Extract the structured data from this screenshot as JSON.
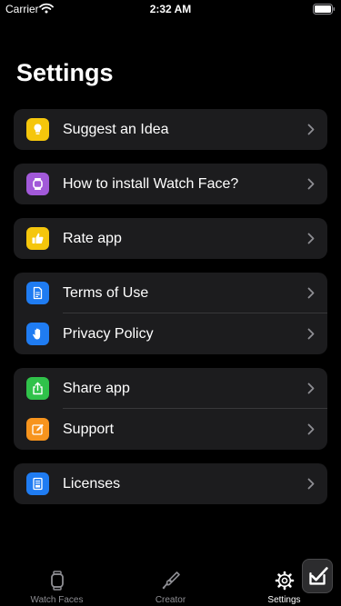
{
  "status": {
    "carrier": "Carrier",
    "time": "2:32 AM"
  },
  "page": {
    "title": "Settings"
  },
  "groups": [
    {
      "rows": [
        {
          "label": "Suggest an Idea",
          "icon": "lightbulb-icon",
          "color": "#f5c60c"
        }
      ]
    },
    {
      "rows": [
        {
          "label": "How to install Watch Face?",
          "icon": "watch-icon",
          "color": "#a259d9"
        }
      ]
    },
    {
      "rows": [
        {
          "label": "Rate app",
          "icon": "thumbs-up-icon",
          "color": "#f5c60c"
        }
      ]
    },
    {
      "rows": [
        {
          "label": "Terms of Use",
          "icon": "document-icon",
          "color": "#1f7cf2"
        },
        {
          "label": "Privacy Policy",
          "icon": "hand-icon",
          "color": "#1f7cf2"
        }
      ]
    },
    {
      "rows": [
        {
          "label": "Share app",
          "icon": "share-icon",
          "color": "#30c24a"
        },
        {
          "label": "Support",
          "icon": "edit-icon",
          "color": "#f7941d"
        }
      ]
    },
    {
      "rows": [
        {
          "label": "Licenses",
          "icon": "license-icon",
          "color": "#1f7cf2"
        }
      ]
    }
  ],
  "tabs": [
    {
      "label": "Watch Faces",
      "icon": "watch-icon",
      "active": false
    },
    {
      "label": "Creator",
      "icon": "brush-icon",
      "active": false
    },
    {
      "label": "Settings",
      "icon": "gear-icon",
      "active": true
    }
  ]
}
